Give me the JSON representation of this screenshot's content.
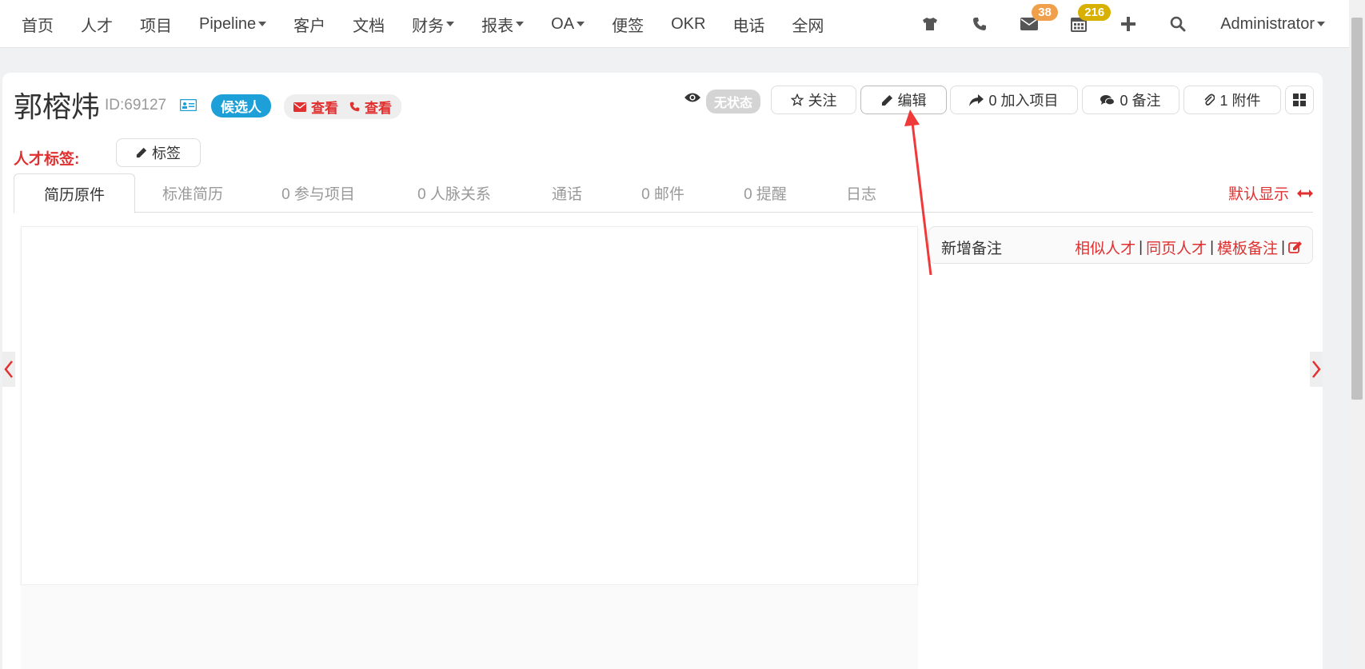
{
  "nav": {
    "items": [
      {
        "label": "首页",
        "dropdown": false
      },
      {
        "label": "人才",
        "dropdown": false
      },
      {
        "label": "项目",
        "dropdown": false
      },
      {
        "label": "Pipeline",
        "dropdown": true
      },
      {
        "label": "客户",
        "dropdown": false
      },
      {
        "label": "文档",
        "dropdown": false
      },
      {
        "label": "财务",
        "dropdown": true
      },
      {
        "label": "报表",
        "dropdown": true
      },
      {
        "label": "OA",
        "dropdown": true
      },
      {
        "label": "便签",
        "dropdown": false
      },
      {
        "label": "OKR",
        "dropdown": false
      },
      {
        "label": "电话",
        "dropdown": false
      },
      {
        "label": "全网",
        "dropdown": false
      }
    ],
    "mail_count": "38",
    "calendar_count": "216",
    "user": "Administrator"
  },
  "candidate": {
    "name": "郭榕炜",
    "id_text": "ID:69127",
    "role_badge": "候选人",
    "email_view": "查看",
    "phone_view": "查看",
    "status": "无状态"
  },
  "actions": {
    "follow": "关注",
    "edit": "编辑",
    "add_project": "0 加入项目",
    "notes": "0 备注",
    "attachments": "1 附件"
  },
  "tags": {
    "label": "人才标签:",
    "button": "标签"
  },
  "tabs": [
    "简历原件",
    "标准简历",
    "0 参与项目",
    "0 人脉关系",
    "通话",
    "0 邮件",
    "0 提醒",
    "日志"
  ],
  "default_display": "默认显示",
  "notes_panel": {
    "title": "新增备注",
    "links": [
      "相似人才",
      "同页人才",
      "模板备注"
    ]
  },
  "colors": {
    "accent_red": "#e03030",
    "badge_blue": "#1da0d8",
    "badge_orange": "#f0a04b",
    "badge_yellow": "#d7b000"
  }
}
